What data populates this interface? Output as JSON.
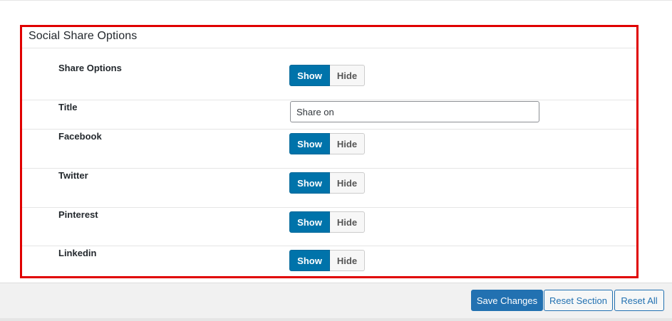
{
  "panel": {
    "title": "Social Share Options",
    "border_color": "#e00000"
  },
  "rows": [
    {
      "label": "Share Options",
      "type": "toggle",
      "show_label": "Show",
      "hide_label": "Hide",
      "selected": "Show"
    },
    {
      "label": "Title",
      "type": "text",
      "value": "Share on"
    },
    {
      "label": "Facebook",
      "type": "toggle",
      "show_label": "Show",
      "hide_label": "Hide",
      "selected": "Show"
    },
    {
      "label": "Twitter",
      "type": "toggle",
      "show_label": "Show",
      "hide_label": "Hide",
      "selected": "Show"
    },
    {
      "label": "Pinterest",
      "type": "toggle",
      "show_label": "Show",
      "hide_label": "Hide",
      "selected": "Show"
    },
    {
      "label": "Linkedin",
      "type": "toggle",
      "show_label": "Show",
      "hide_label": "Hide",
      "selected": "Show"
    }
  ],
  "footer": {
    "save_label": "Save Changes",
    "reset_section_label": "Reset Section",
    "reset_all_label": "Reset All"
  },
  "colors": {
    "accent": "#0073aa",
    "footer_primary": "#2271b1"
  }
}
